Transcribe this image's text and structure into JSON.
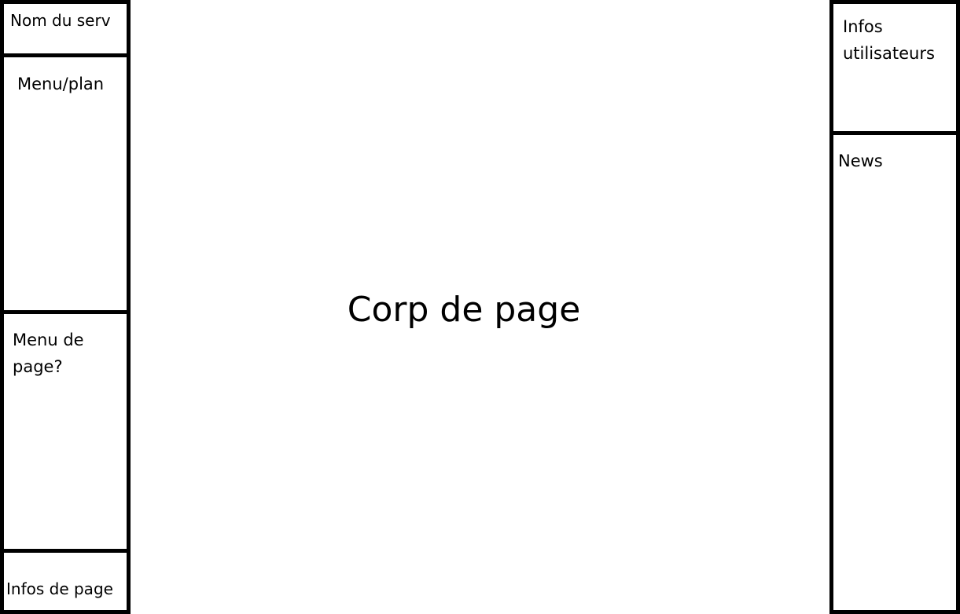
{
  "left_column": {
    "server_name": "Nom du serv",
    "menu_plan": "Menu/plan",
    "page_menu": "Menu de\npage?",
    "page_info": "Infos de page"
  },
  "right_column": {
    "user_info": "Infos\nutilisateurs",
    "news": "News"
  },
  "center": {
    "body_label": "Corp de page"
  }
}
